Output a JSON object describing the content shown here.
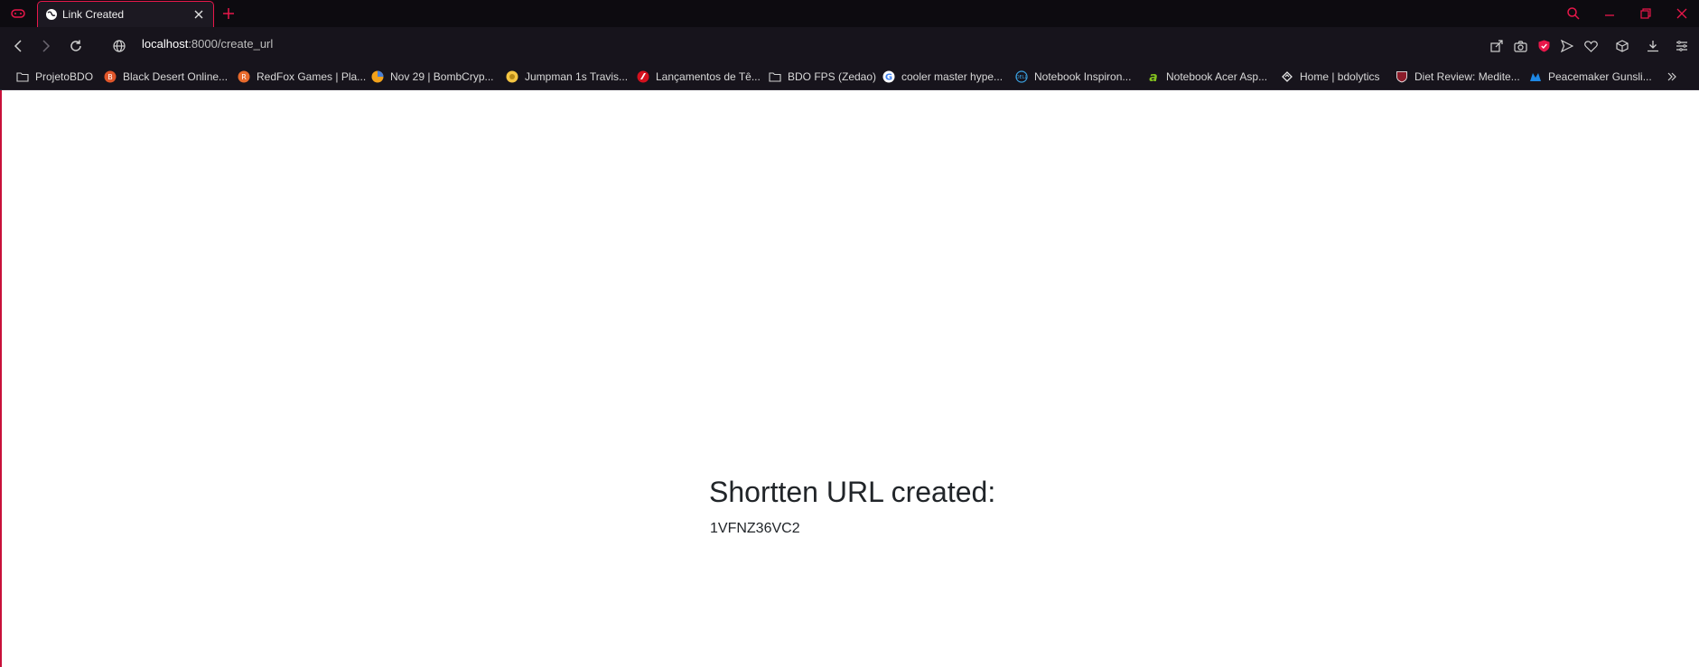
{
  "tab": {
    "title": "Link Created"
  },
  "address": {
    "host": "localhost",
    "path": ":8000/create_url"
  },
  "bookmarks": [
    {
      "label": "ProjetoBDO",
      "icon": "folder-icon"
    },
    {
      "label": "Black Desert Online...",
      "icon": "site-icon"
    },
    {
      "label": "RedFox Games | Pla...",
      "icon": "site-icon"
    },
    {
      "label": "Nov 29 | BombCryp...",
      "icon": "site-icon"
    },
    {
      "label": "Jumpman 1s Travis...",
      "icon": "site-icon"
    },
    {
      "label": "Lançamentos de Tê...",
      "icon": "site-icon"
    },
    {
      "label": "BDO FPS (Zedao)",
      "icon": "folder-icon"
    },
    {
      "label": "cooler master hype...",
      "icon": "google-icon"
    },
    {
      "label": "Notebook Inspiron...",
      "icon": "dell-icon"
    },
    {
      "label": "Notebook Acer Asp...",
      "icon": "acer-icon"
    },
    {
      "label": "Home | bdolytics",
      "icon": "site-icon"
    },
    {
      "label": "Diet Review: Medite...",
      "icon": "site-icon"
    },
    {
      "label": "Peacemaker Gunsli...",
      "icon": "site-icon"
    }
  ],
  "page": {
    "heading": "Shortten URL created:",
    "short_code": "1VFNZ36VC2"
  },
  "colors": {
    "accent": "#e8174a",
    "chrome": "#17141c",
    "text": "#212529"
  }
}
